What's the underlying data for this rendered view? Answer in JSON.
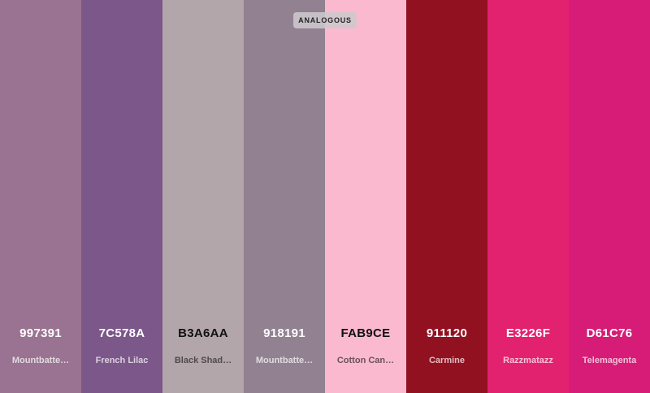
{
  "badge": "ANALOGOUS",
  "swatches": [
    {
      "hex": "997391",
      "name": "Mountbatten Pink",
      "display_name": "Mountbatte…",
      "color": "#997391",
      "text": "light"
    },
    {
      "hex": "7C578A",
      "name": "French Lilac",
      "display_name": "French Lilac",
      "color": "#7C578A",
      "text": "light"
    },
    {
      "hex": "B3A6AA",
      "name": "Black Shadows",
      "display_name": "Black Shad…",
      "color": "#B3A6AA",
      "text": "dark"
    },
    {
      "hex": "918191",
      "name": "Mountbatten Pink",
      "display_name": "Mountbatte…",
      "color": "#918191",
      "text": "light"
    },
    {
      "hex": "FAB9CE",
      "name": "Cotton Candy",
      "display_name": "Cotton Can…",
      "color": "#FAB9CE",
      "text": "dark"
    },
    {
      "hex": "911120",
      "name": "Carmine",
      "display_name": "Carmine",
      "color": "#911120",
      "text": "light"
    },
    {
      "hex": "E3226F",
      "name": "Razzmatazz",
      "display_name": "Razzmatazz",
      "color": "#E3226F",
      "text": "light"
    },
    {
      "hex": "D61C76",
      "name": "Telemagenta",
      "display_name": "Telemagenta",
      "color": "#D61C76",
      "text": "light"
    }
  ]
}
